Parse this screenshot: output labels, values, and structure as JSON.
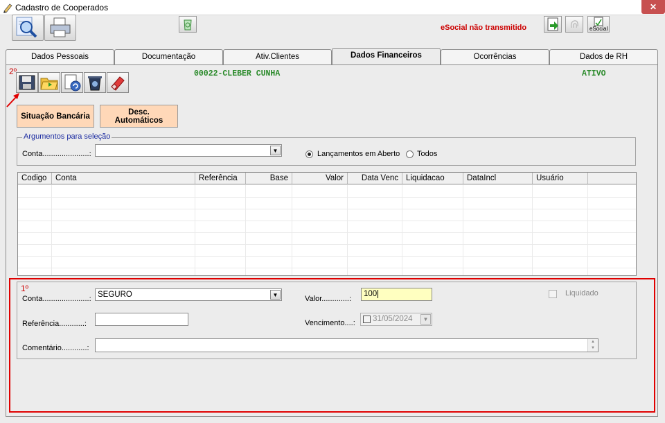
{
  "window": {
    "title": "Cadastro de Cooperados",
    "close_label": "✕"
  },
  "toolbar": {
    "esocial_status": "eSocial não transmitido",
    "esocial_button_label": "eSocial",
    "status_color": "#cc0000"
  },
  "tabs": [
    {
      "label": "Dados Pessoais",
      "active": false
    },
    {
      "label": "Documentação",
      "active": false
    },
    {
      "label": "Ativ.Clientes",
      "active": false
    },
    {
      "label": "Dados Financeiros",
      "active": true
    },
    {
      "label": "Ocorrências",
      "active": false
    },
    {
      "label": "Dados de RH",
      "active": false
    }
  ],
  "cooperado": {
    "name": "00022-CLEBER CUNHA",
    "status": "ATIVO",
    "color": "#2a8a2a"
  },
  "annotations": {
    "step2": "2º",
    "step1": "1º",
    "color": "#e00000"
  },
  "buttons": {
    "situacao_bancaria": "Situação Bancária",
    "desc_automaticos_line1": "Desc.",
    "desc_automaticos_line2": "Automáticos"
  },
  "selection": {
    "group_title": "Argumentos para seleção",
    "conta_label": "Conta......................:",
    "conta_value": "",
    "radio_aberto": "Lançamentos em Aberto",
    "radio_todos": "Todos",
    "selected": "aberto"
  },
  "grid": {
    "columns": [
      "Codigo",
      "Conta",
      "Referência",
      "Base",
      "Valor",
      "Data Venc",
      "Liquidacao",
      "DataIncl",
      "Usuário"
    ],
    "rows": []
  },
  "form": {
    "conta_label": "Conta......................:",
    "conta_value": "SEGURO",
    "referencia_label": "Referência............:",
    "referencia_value": "",
    "comentario_label": "Comentário............:",
    "comentario_value": "",
    "valor_label": "Valor.............:",
    "valor_value": "100",
    "vencimento_label": "Vencimento....:",
    "vencimento_value": "31/05/2024",
    "liquidado_label": "Liquidado",
    "liquidado_checked": false
  }
}
